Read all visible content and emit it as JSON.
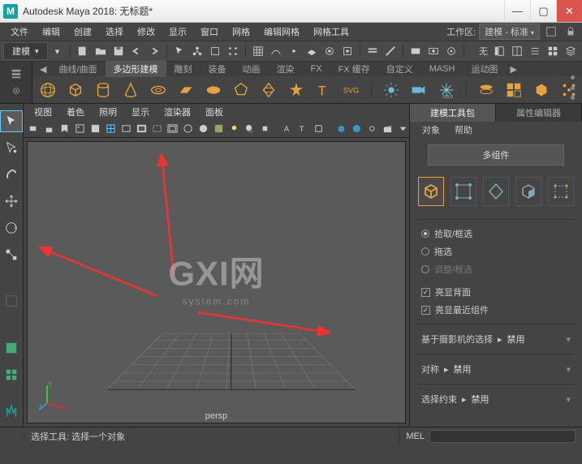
{
  "title": "Autodesk Maya 2018: 无标题*",
  "menus": [
    "文件",
    "编辑",
    "创建",
    "选择",
    "修改",
    "显示",
    "窗口",
    "网格",
    "编辑网格",
    "网格工具"
  ],
  "workspace": {
    "label": "工作区:",
    "value": "建模 - 标准"
  },
  "toolbar_mode": "建模",
  "shelf": {
    "tabs_left": "◀",
    "tabs": [
      "曲线/曲面",
      "多边形建模",
      "雕刻",
      "装备",
      "动画",
      "渲染",
      "FX",
      "FX 缓存",
      "自定义",
      "MASH",
      "运动图"
    ],
    "tabs_right": "▶",
    "active_tab": "多边形建模"
  },
  "viewport_menus": [
    "视图",
    "着色",
    "照明",
    "显示",
    "渲染器",
    "面板"
  ],
  "viewport_label": "persp",
  "axis": {
    "x": "x",
    "y": "y",
    "z": "z"
  },
  "watermark": {
    "big": "GXI网",
    "small": "system.com"
  },
  "rpanel": {
    "tabs": [
      "建模工具包",
      "属性编辑器"
    ],
    "active_tab": "建模工具包",
    "menus": [
      "对象",
      "帮助"
    ],
    "multi_comp_btn": "多组件",
    "radios": [
      {
        "label": "拾取/框选",
        "on": true
      },
      {
        "label": "拖选",
        "on": false
      },
      {
        "label": "调整/框选",
        "on": false,
        "disabled": true
      }
    ],
    "checks": [
      {
        "label": "亮显背面",
        "on": true
      },
      {
        "label": "亮显最近组件",
        "on": true
      }
    ],
    "lines": [
      {
        "label": "基于摄影机的选择",
        "sep": "▸",
        "value": "禁用"
      },
      {
        "label": "对称",
        "sep": "▸",
        "value": "禁用"
      },
      {
        "label": "选择约束",
        "sep": "▸",
        "value": "禁用"
      }
    ]
  },
  "status": {
    "text": "选择工具: 选择一个对象",
    "mel": "MEL"
  }
}
